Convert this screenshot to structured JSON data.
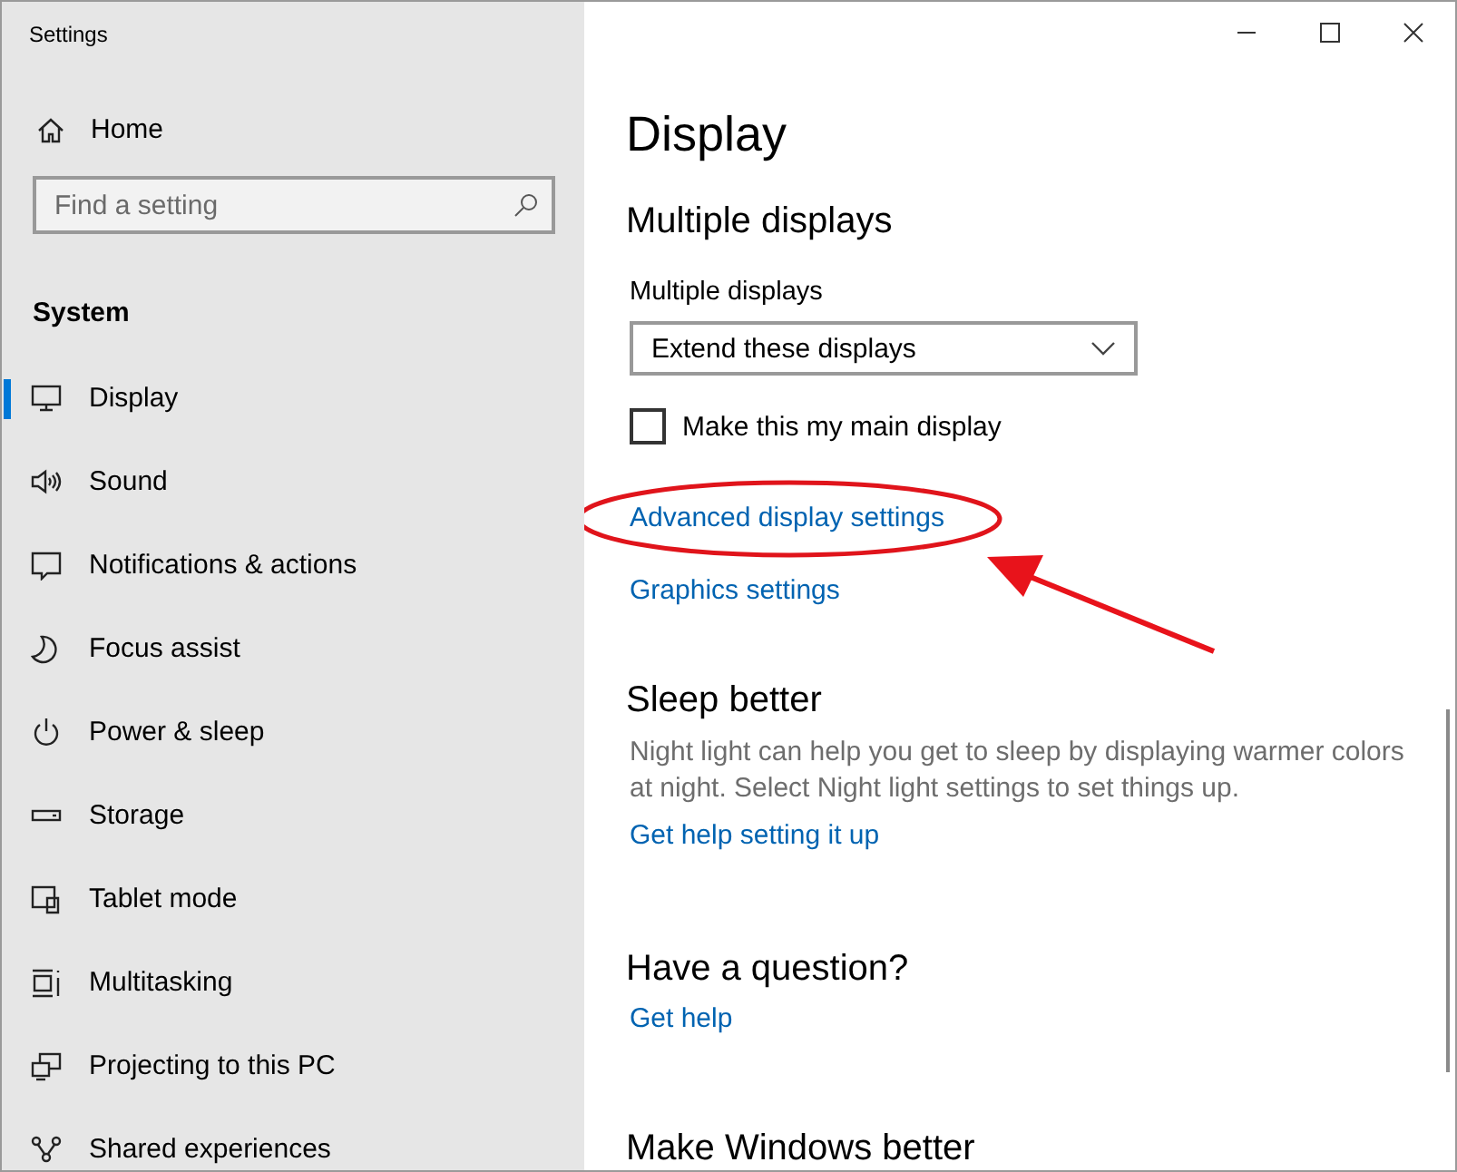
{
  "window": {
    "title": "Settings"
  },
  "sidebar": {
    "home": {
      "label": "Home"
    },
    "search": {
      "placeholder": "Find a setting"
    },
    "section": "System",
    "items": [
      {
        "label": "Display",
        "selected": true
      },
      {
        "label": "Sound",
        "selected": false
      },
      {
        "label": "Notifications & actions",
        "selected": false
      },
      {
        "label": "Focus assist",
        "selected": false
      },
      {
        "label": "Power & sleep",
        "selected": false
      },
      {
        "label": "Storage",
        "selected": false
      },
      {
        "label": "Tablet mode",
        "selected": false
      },
      {
        "label": "Multitasking",
        "selected": false
      },
      {
        "label": "Projecting to this PC",
        "selected": false
      },
      {
        "label": "Shared experiences",
        "selected": false
      }
    ]
  },
  "page": {
    "title": "Display"
  },
  "multiple_displays": {
    "heading": "Multiple displays",
    "label": "Multiple displays",
    "dropdown": {
      "value": "Extend these displays"
    },
    "checkbox": {
      "label": "Make this my main display",
      "checked": false
    },
    "links": [
      {
        "label": "Advanced display settings",
        "circled": true
      },
      {
        "label": "Graphics settings",
        "circled": false
      }
    ]
  },
  "sleep_better": {
    "heading": "Sleep better",
    "text": "Night light can help you get to sleep by displaying warmer colors at night. Select Night light settings to set things up.",
    "link": "Get help setting it up"
  },
  "question": {
    "heading": "Have a question?",
    "link": "Get help"
  },
  "make_better": {
    "heading": "Make Windows better"
  }
}
